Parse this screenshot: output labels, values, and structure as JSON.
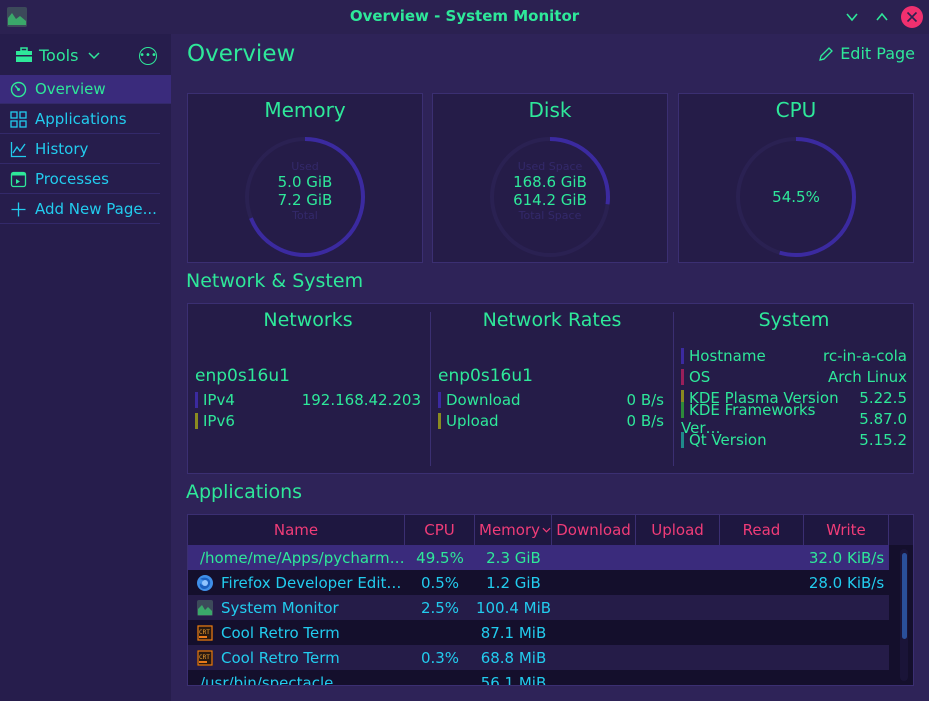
{
  "window": {
    "title": "Overview - System Monitor"
  },
  "sidebar": {
    "tools_label": "Tools",
    "items": [
      {
        "label": "Overview",
        "icon": "gauge-icon"
      },
      {
        "label": "Applications",
        "icon": "grid-icon"
      },
      {
        "label": "History",
        "icon": "line-chart-icon"
      },
      {
        "label": "Processes",
        "icon": "process-icon"
      },
      {
        "label": "Add New Page...",
        "icon": "plus-icon"
      }
    ]
  },
  "main": {
    "title": "Overview",
    "edit_label": "Edit Page"
  },
  "memory": {
    "title": "Memory",
    "used_label": "Used",
    "used_value": "5.0 GiB",
    "total_value": "7.2 GiB",
    "total_label": "Total",
    "fraction": 0.69
  },
  "disk": {
    "title": "Disk",
    "used_label": "Used Space",
    "used_value": "168.6 GiB",
    "total_value": "614.2 GiB",
    "total_label": "Total Space",
    "fraction": 0.27
  },
  "cpu": {
    "title": "CPU",
    "value": "54.5%",
    "fraction": 0.545
  },
  "network_system": {
    "heading": "Network & System",
    "networks": {
      "title": "Networks",
      "interface": "enp0s16u1",
      "rows": [
        {
          "label": "IPv4",
          "value": "192.168.42.203",
          "color": "#3b2aa0"
        },
        {
          "label": "IPv6",
          "value": "",
          "color": "#8a8a20"
        }
      ]
    },
    "rates": {
      "title": "Network Rates",
      "interface": "enp0s16u1",
      "rows": [
        {
          "label": "Download",
          "value": "0 B/s",
          "color": "#3b2aa0"
        },
        {
          "label": "Upload",
          "value": "0 B/s",
          "color": "#8a8a20"
        }
      ]
    },
    "system": {
      "title": "System",
      "rows": [
        {
          "label": "Hostname",
          "value": "rc-in-a-cola",
          "color": "#3b2aa0"
        },
        {
          "label": "OS",
          "value": "Arch Linux",
          "color": "#9a1f5a"
        },
        {
          "label": "KDE Plasma Version",
          "value": "5.22.5",
          "color": "#8a8a20"
        },
        {
          "label": "KDE Frameworks Ver…",
          "value": "5.87.0",
          "color": "#2e8a3a"
        },
        {
          "label": "Qt Version",
          "value": "5.15.2",
          "color": "#1f8a8a"
        }
      ]
    }
  },
  "applications": {
    "heading": "Applications",
    "columns": [
      "Name",
      "CPU",
      "Memory",
      "Download",
      "Upload",
      "Read",
      "Write"
    ],
    "rows": [
      {
        "name": "/home/me/Apps/pycharm-…",
        "cpu": "49.5%",
        "memory": "2.3 GiB",
        "download": "",
        "upload": "",
        "read": "",
        "write": "32.0 KiB/s",
        "icon": ""
      },
      {
        "name": "Firefox Developer Edition",
        "cpu": "0.5%",
        "memory": "1.2 GiB",
        "download": "",
        "upload": "",
        "read": "",
        "write": "28.0 KiB/s",
        "icon": "firefox-icon"
      },
      {
        "name": "System Monitor",
        "cpu": "2.5%",
        "memory": "100.4 MiB",
        "download": "",
        "upload": "",
        "read": "",
        "write": "",
        "icon": "system-monitor-icon"
      },
      {
        "name": "Cool Retro Term",
        "cpu": "",
        "memory": "87.1 MiB",
        "download": "",
        "upload": "",
        "read": "",
        "write": "",
        "icon": "retro-term-icon"
      },
      {
        "name": "Cool Retro Term",
        "cpu": "0.3%",
        "memory": "68.8 MiB",
        "download": "",
        "upload": "",
        "read": "",
        "write": "",
        "icon": "retro-term-icon"
      },
      {
        "name": "/usr/bin/spectacle",
        "cpu": "",
        "memory": "56.1 MiB",
        "download": "",
        "upload": "",
        "read": "",
        "write": "",
        "icon": ""
      }
    ]
  },
  "colors": {
    "accent": "#2ee89a",
    "link": "#22ccee",
    "header_text": "#f03c78",
    "close_button": "#f0306f"
  }
}
